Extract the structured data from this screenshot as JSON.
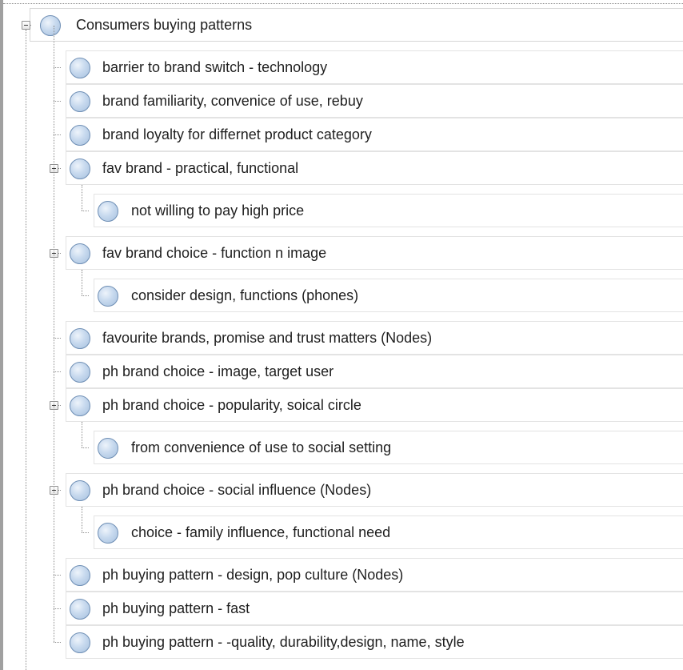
{
  "tree": {
    "root": {
      "label": "Consumers buying patterns",
      "expanded": true,
      "icon": "node-circle-icon"
    },
    "children": [
      {
        "label": "barrier to brand switch - technology",
        "children": []
      },
      {
        "label": "brand familiarity, convenice of use, rebuy",
        "children": []
      },
      {
        "label": "brand loyalty for differnet product category",
        "children": []
      },
      {
        "label": "fav brand - practical, functional",
        "expanded": true,
        "children": [
          {
            "label": "not willing to pay high price"
          }
        ]
      },
      {
        "label": "fav brand choice - function n image",
        "expanded": true,
        "children": [
          {
            "label": "consider design, functions (phones)"
          }
        ]
      },
      {
        "label": "favourite brands, promise and trust matters (Nodes)",
        "children": []
      },
      {
        "label": "ph brand choice - image, target user",
        "children": []
      },
      {
        "label": "ph brand choice - popularity, soical circle",
        "expanded": true,
        "children": [
          {
            "label": "from convenience of use to social setting"
          }
        ]
      },
      {
        "label": "ph brand choice - social influence (Nodes)",
        "expanded": true,
        "children": [
          {
            "label": "choice - family influence, functional need"
          }
        ]
      },
      {
        "label": "ph buying pattern - design, pop culture (Nodes)",
        "children": []
      },
      {
        "label": "ph buying pattern - fast",
        "children": []
      },
      {
        "label": "ph buying pattern - -quality, durability,design, name, style",
        "children": []
      }
    ]
  },
  "colors": {
    "node_fill": "#c7d9ee",
    "node_border": "#6f8fb5",
    "row_border": "#e3e3e3",
    "connector": "#8f8f8f",
    "text": "#1f1f1f"
  }
}
